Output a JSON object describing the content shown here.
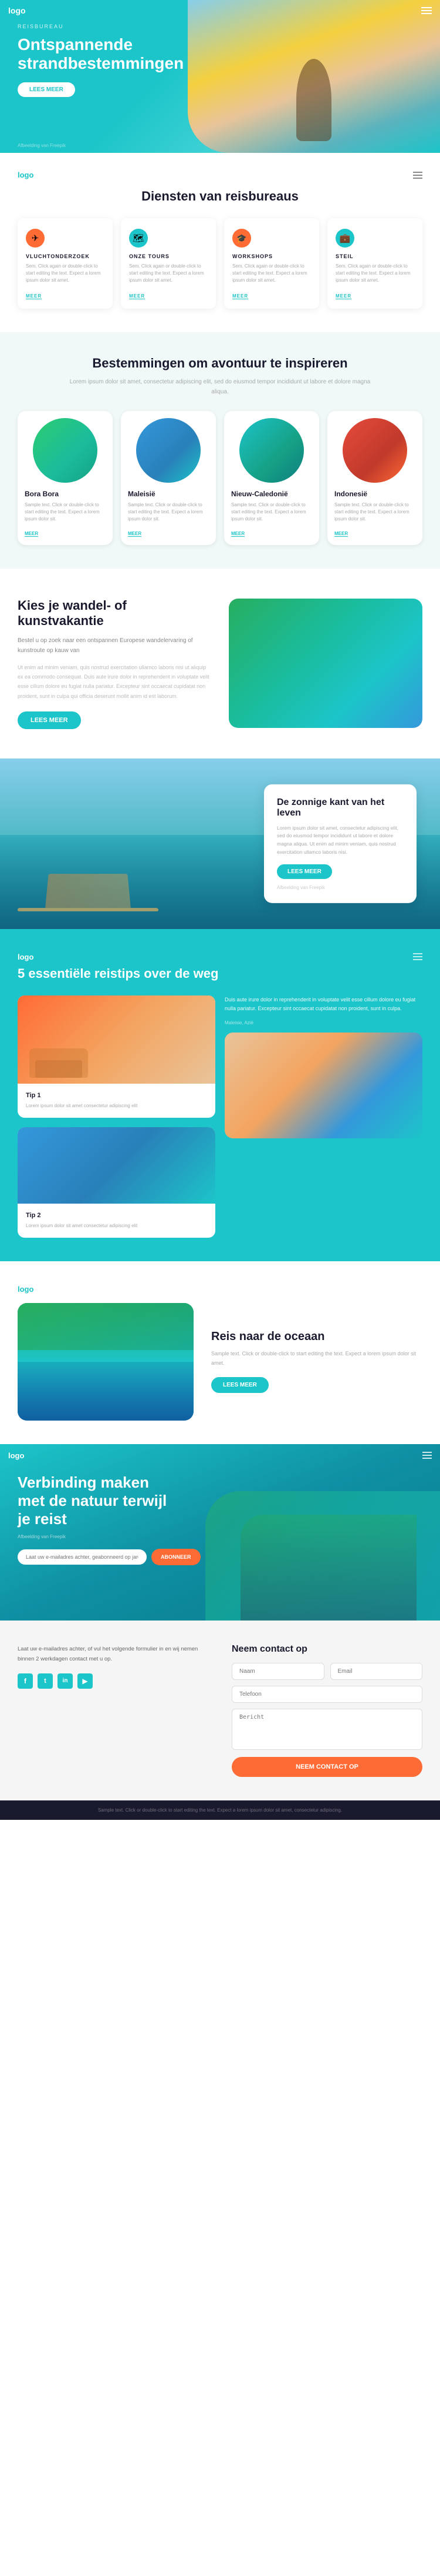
{
  "brand": {
    "logo": "logo"
  },
  "hero": {
    "label": "REISBUREAU",
    "title": "Ontspannende strandbestemmingen",
    "button": "LEES MEER",
    "footer_text": "Afbeelding van Freepik"
  },
  "services": {
    "section_title": "Diensten van reisbureaus",
    "cards": [
      {
        "icon": "✈",
        "icon_color": "orange",
        "title": "VLUCHTONDERZOEK",
        "text": "Sem. Click again or double-click to start editing the text. Expect a lorem ipsum dolor sit amet.",
        "link": "MEER"
      },
      {
        "icon": "🗺",
        "icon_color": "teal",
        "title": "ONZE TOURS",
        "text": "Sem. Click again or double-click to start editing the text. Expect a lorem ipsum dolor sit amet.",
        "link": "MEER"
      },
      {
        "icon": "🎓",
        "icon_color": "orange",
        "title": "WORKSHOPS",
        "text": "Sem. Click again or double-click to start editing the text. Expect a lorem ipsum dolor sit amet.",
        "link": "MEER"
      },
      {
        "icon": "💼",
        "icon_color": "teal",
        "title": "STEIL",
        "text": "Sem. Click again or double-click to start editing the text. Expect a lorem ipsum dolor sit amet.",
        "link": "MEER"
      }
    ]
  },
  "destinations": {
    "section_title": "Bestemmingen om avontuur te inspireren",
    "subtitle": "Lorem ipsum dolor sit amet, consectetur adipiscing elit, sed do eiusmod tempor incididunt ut labore et dolore magna aliqua.",
    "cards": [
      {
        "name": "Bora Bora",
        "text": "Sample text. Click or double-click to start editing the text. Expect a lorem ipsum dolor sit.",
        "link": "MEER",
        "color": "dest-borabora"
      },
      {
        "name": "Maleisië",
        "text": "Sample text. Click or double-click to start editing the text. Expect a lorem ipsum dolor sit.",
        "link": "MEER",
        "color": "dest-maleisie"
      },
      {
        "name": "Nieuw-Caledonië",
        "text": "Sample text. Click or double-click to start editing the text. Expect a lorem ipsum dolor sit.",
        "link": "MEER",
        "color": "dest-nw-caledonien"
      },
      {
        "name": "Indonesië",
        "text": "Sample text. Click or double-click to start editing the text. Expect a lorem ipsum dolor sit.",
        "link": "MEER",
        "color": "dest-indonesie"
      }
    ]
  },
  "wander": {
    "title": "Kies je wandel- of kunstvakantie",
    "subtitle": "Bestel u op zoek naar een ontspannen Europese wandelervaring of kunstroute op kauw van",
    "text": "Ut enim ad minim veniam, quis nostrud exercitation ullamco laboris nisi ut aliquip ex ea commodo consequat. Duis aute irure dolor in reprehenderit in voluptate velit esse cillum dolore eu fugiat nulla pariatur. Excepteur sint occaecat cupidatat non proident, sunt in culpa qui officia deserunt mollit anim id est laborum.",
    "button": "LEES MEER"
  },
  "sunny": {
    "title": "De zonnige kant van het leven",
    "text": "Lorem ipsum dolor sit amet, consectetur adipiscing elit, sed do eiusmod tempor incididunt ut labore et dolore magna aliqua. Ut enim ad minim veniam, quis nostrud exercitation ullamco laboris nisi.",
    "button": "LEES MEER",
    "footer_text": "Afbeelding van Freepik"
  },
  "tips": {
    "title": "5 essentiële reistips over de weg",
    "card1": {
      "title": "Tip 1",
      "text": "Lorem ipsum dolor sit amet consectetur adipiscing elit"
    },
    "card2": {
      "title": "Tip 2",
      "text": "Lorem ipsum dolor sit amet consectetur adipiscing elit"
    },
    "right_text": "Duis aute irure dolor in reprehenderit in voluptate velit esse cillum dolore eu fugiat nulla pariatur. Excepteur sint occaecat cupidatat non proident, sunt in culpa.",
    "meta": "Maleisie, Azië"
  },
  "ocean": {
    "title": "Reis naar de oceaan",
    "text": "Sample text. Click or double-click to start editing the text. Expect a lorem ipsum dolor sit amet.",
    "button": "LEES MEER"
  },
  "footer_hero": {
    "title": "Verbinding maken met de natuur terwijl je reist",
    "sub": "Afbeelding van Freepik",
    "input_placeholder": "Laat uw e-mailadres achter, geabonneerd op jaren nieuws",
    "button": "ABONNEER"
  },
  "contact": {
    "form_title": "Neem contact op",
    "intro": "Laat uw e-mailadres achter, of vul het volgende formulier in en wij nemen binnen 2 werkdagen contact met u op.",
    "name_placeholder": "Naam",
    "email_placeholder": "Email",
    "phone_placeholder": "Telefoon",
    "message_placeholder": "Bericht",
    "submit": "NEEM CONTACT OP",
    "social": [
      "f",
      "t",
      "in",
      "y"
    ]
  },
  "footer_bar": {
    "text": "Sample text. Click or double-click to start editing the text. Expect a lorem ipsum dolor sit amet, consectetur adipiscing."
  }
}
